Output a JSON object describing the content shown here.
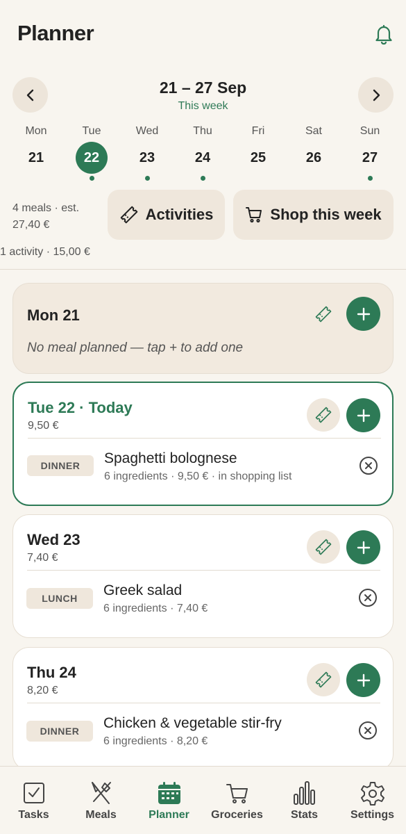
{
  "header": {
    "title": "Planner"
  },
  "week": {
    "range": "21 – 27 Sep",
    "subtitle": "This week"
  },
  "days": [
    {
      "name": "Mon",
      "num": "21",
      "selected": false,
      "dot": false
    },
    {
      "name": "Tue",
      "num": "22",
      "selected": true,
      "dot": true
    },
    {
      "name": "Wed",
      "num": "23",
      "selected": false,
      "dot": true
    },
    {
      "name": "Thu",
      "num": "24",
      "selected": false,
      "dot": true
    },
    {
      "name": "Fri",
      "num": "25",
      "selected": false,
      "dot": false
    },
    {
      "name": "Sat",
      "num": "26",
      "selected": false,
      "dot": false
    },
    {
      "name": "Sun",
      "num": "27",
      "selected": false,
      "dot": true
    }
  ],
  "summary": {
    "meals": "4 meals · est. 27,40 €",
    "activity": "1 activity · 15,00 €"
  },
  "actions": {
    "activities": "Activities",
    "shop": "Shop this week"
  },
  "cards": {
    "mon": {
      "title": "Mon 21",
      "empty": "No meal planned — tap + to add one"
    },
    "tue": {
      "title": "Tue 22",
      "today": " · Today",
      "total": "9,50 €",
      "tag": "DINNER",
      "meal": "Spaghetti bolognese",
      "meta": "6 ingredients · 9,50 € · in shopping list"
    },
    "wed": {
      "title": "Wed 23",
      "total": "7,40 €",
      "tag": "LUNCH",
      "meal": "Greek salad",
      "meta": "6 ingredients · 7,40 €"
    },
    "thu": {
      "title": "Thu 24",
      "total": "8,20 €",
      "tag": "DINNER",
      "meal": "Chicken & vegetable stir-fry",
      "meta": "6 ingredients · 8,20 €"
    }
  },
  "nav": [
    {
      "label": "Tasks",
      "icon": "tasks-icon"
    },
    {
      "label": "Meals",
      "icon": "meals-icon"
    },
    {
      "label": "Planner",
      "icon": "planner-icon",
      "active": true
    },
    {
      "label": "Groceries",
      "icon": "groceries-icon"
    },
    {
      "label": "Stats",
      "icon": "stats-icon"
    },
    {
      "label": "Settings",
      "icon": "settings-icon"
    }
  ],
  "colors": {
    "accent": "#2d7a56",
    "background": "#f8f5ef",
    "chip": "#efe7dc"
  }
}
